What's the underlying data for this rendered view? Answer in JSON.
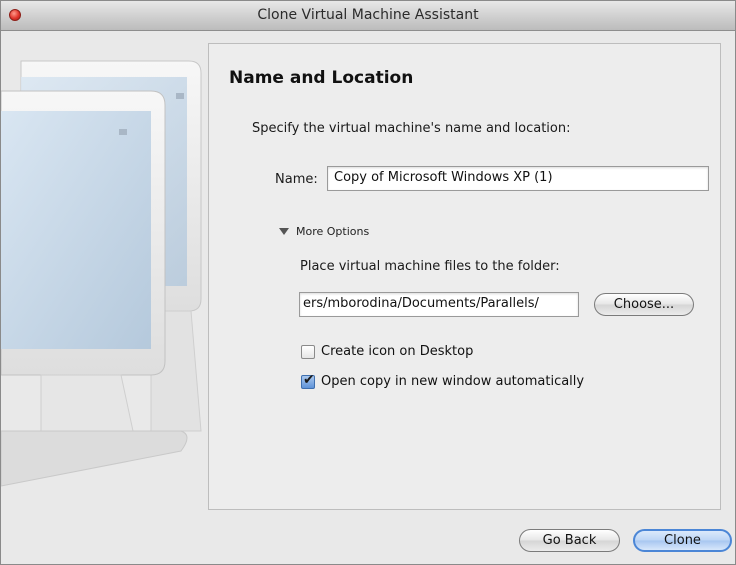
{
  "window": {
    "title": "Clone Virtual Machine Assistant"
  },
  "panel": {
    "title": "Name and Location",
    "instruction": "Specify the virtual machine's name and location:",
    "name_label": "Name:",
    "name_value": "Copy of Microsoft Windows XP (1)",
    "more_options_label": "More Options",
    "folder_label": "Place virtual machine files to the folder:",
    "folder_value": "ers/mborodina/Documents/Parallels/",
    "choose_label": "Choose...",
    "create_icon_label": "Create icon on Desktop",
    "create_icon_checked": false,
    "open_copy_label": "Open copy in new window automatically",
    "open_copy_checked": true
  },
  "footer": {
    "go_back_label": "Go Back",
    "clone_label": "Clone"
  },
  "colors": {
    "accent": "#4b86d6",
    "close": "#e0342b"
  },
  "icons": {
    "close": "close-icon",
    "disclosure": "disclosure-triangle-icon",
    "checkmark": "checkmark-icon"
  }
}
